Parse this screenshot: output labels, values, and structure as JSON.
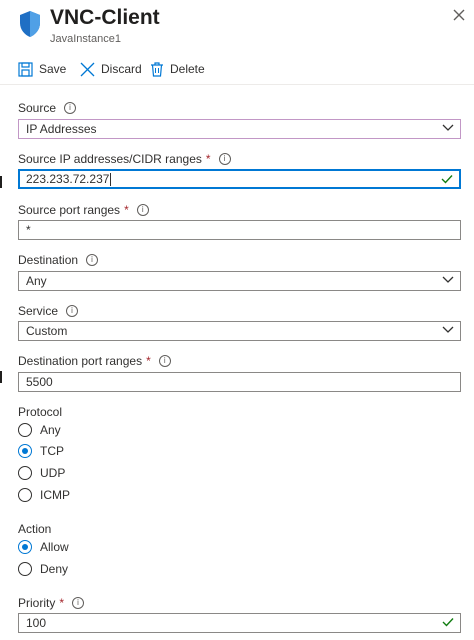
{
  "header": {
    "title": "VNC-Client",
    "subtitle": "JavaInstance1"
  },
  "toolbar": {
    "save_label": "Save",
    "discard_label": "Discard",
    "delete_label": "Delete"
  },
  "form": {
    "source": {
      "label": "Source",
      "value": "IP Addresses"
    },
    "source_ip": {
      "label": "Source IP addresses/CIDR ranges",
      "value": "223.233.72.237"
    },
    "source_port": {
      "label": "Source port ranges",
      "value": "*"
    },
    "destination": {
      "label": "Destination",
      "value": "Any"
    },
    "service": {
      "label": "Service",
      "value": "Custom"
    },
    "dest_port": {
      "label": "Destination port ranges",
      "value": "5500"
    },
    "protocol": {
      "label": "Protocol",
      "options": [
        "Any",
        "TCP",
        "UDP",
        "ICMP"
      ],
      "selected": "TCP"
    },
    "action": {
      "label": "Action",
      "options": [
        "Allow",
        "Deny"
      ],
      "selected": "Allow"
    },
    "priority": {
      "label": "Priority",
      "value": "100"
    }
  },
  "colors": {
    "accent": "#0078d4",
    "required": "#a4262c",
    "focus_border": "#c297c6"
  },
  "icons": [
    "shield-icon",
    "close-icon",
    "save-icon",
    "discard-icon",
    "delete-icon",
    "info-icon",
    "chevron-down-icon",
    "check-icon"
  ]
}
